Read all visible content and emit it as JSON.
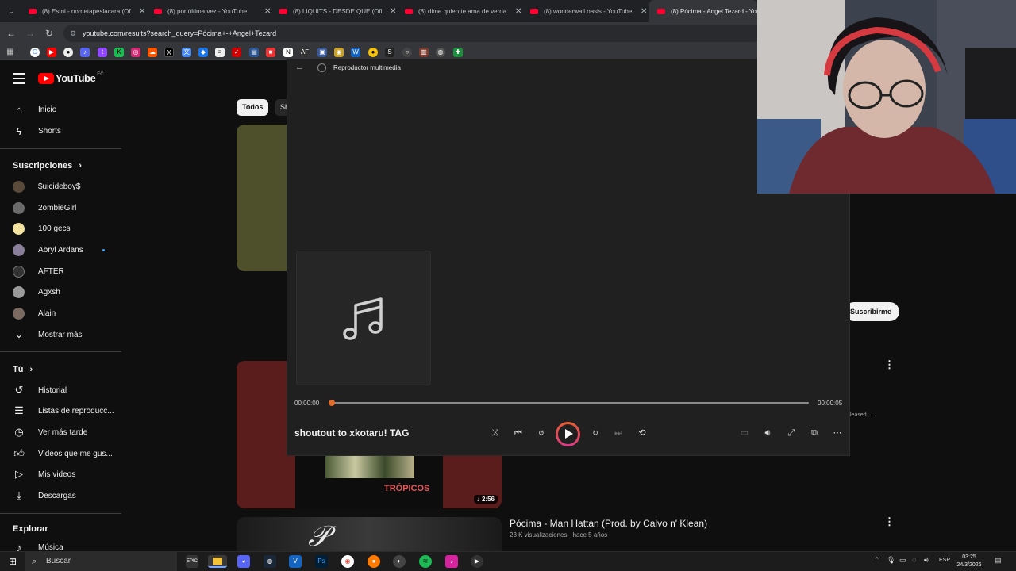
{
  "browser": {
    "tabs": [
      {
        "title": "(8) Esmi - nometapeslacara (Off",
        "active": false
      },
      {
        "title": "(8) por última vez - YouTube",
        "active": false
      },
      {
        "title": "(8) LIQUITS - DESDE QUE (Offic",
        "active": false
      },
      {
        "title": "(8) dime quien te ama de verda",
        "active": false
      },
      {
        "title": "(8) wonderwall oasis - YouTube",
        "active": false
      },
      {
        "title": "(8) Pócima - Angel Tezard - You",
        "active": true
      }
    ],
    "url": "youtube.com/results?search_query=Pócima+-+Angel+Tezard"
  },
  "youtube": {
    "logo_text": "YouTube",
    "country_code": "EC",
    "sidebar": {
      "home": "Inicio",
      "shorts": "Shorts",
      "subscriptions_header": "Suscripciones",
      "subscriptions": [
        {
          "name": "$uicideboy$",
          "color": "#5a4a3a"
        },
        {
          "name": "2ombieGirl",
          "color": "#6b6b6b"
        },
        {
          "name": "100 gecs",
          "color": "#f4e3a0"
        },
        {
          "name": "Abryl Ardans",
          "color": "#8a7f9a"
        },
        {
          "name": "AFTER",
          "color": "#333333"
        },
        {
          "name": "Agxsh",
          "color": "#9a9a9a"
        },
        {
          "name": "Alain",
          "color": "#7a6a60"
        }
      ],
      "show_more": "Mostrar más",
      "you_header": "Tú",
      "you_items": [
        "Historial",
        "Listas de reproducc...",
        "Ver más tarde",
        "Videos que me gus...",
        "Mis videos",
        "Descargas"
      ],
      "explore_header": "Explorar",
      "explore_items": [
        "Música"
      ]
    },
    "chips": [
      "Todos",
      "Sh"
    ],
    "videos": [
      {
        "title": "Pócima - Man Hattan (Prod. by Calvo n' Klean)",
        "meta": "23 K visualizaciones · hace 5 años"
      }
    ],
    "duration_badge": "2:56",
    "partial_meta": "leased ...",
    "subscribe_label": "Suscribirme"
  },
  "player": {
    "app_title": "Reproductor multimedia",
    "current_time": "00:00:00",
    "total_time": "00:00:05",
    "progress": 0.0,
    "track_title": "shoutout to xkotaru! TAG",
    "accent_color": "#e06b2a"
  },
  "taskbar": {
    "search_label": "Buscar",
    "language": "ESP",
    "time": "03:25",
    "date": "24/3/2026"
  }
}
